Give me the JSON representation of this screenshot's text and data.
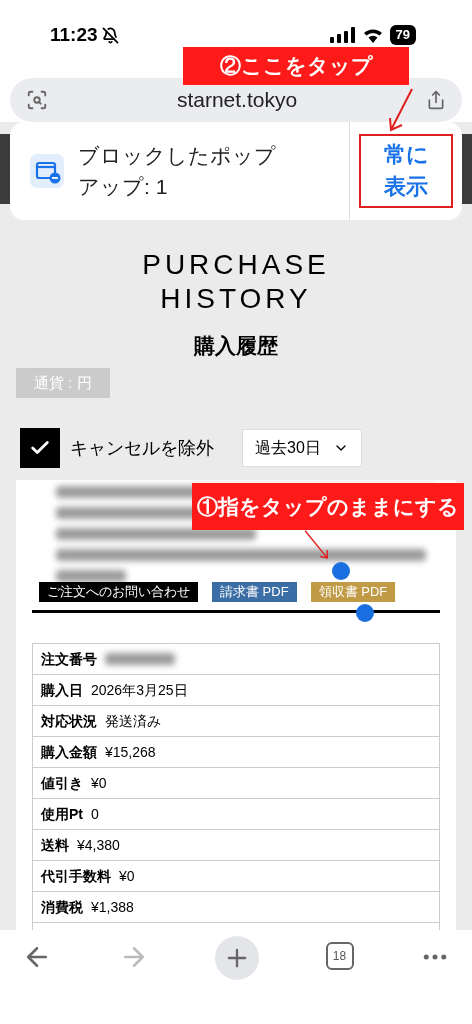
{
  "status_bar": {
    "time": "11:23",
    "battery": "79"
  },
  "address_bar": {
    "url": "starnet.tokyo"
  },
  "popup_notice": {
    "message": "ブロックしたポップアップ: 1",
    "action": "常に表示"
  },
  "annotations": [
    {
      "kind": "top",
      "text": "②ここをタップ"
    },
    {
      "kind": "middle",
      "text": "①指をタップのままにする"
    }
  ],
  "page": {
    "title": "PURCHASE HISTORY",
    "subtitle": "購入履歴",
    "currency": "通貨 : 円",
    "filter": {
      "label": "キャンセルを除外",
      "checked": true
    },
    "period": {
      "value": "過去30日"
    },
    "order_buttons": [
      {
        "label": "ご注文へのお問い合わせ",
        "color": "#000000"
      },
      {
        "label": "請求書 PDF",
        "color": "#3a6ea5"
      },
      {
        "label": "領収書 PDF",
        "color": "#c09a45"
      }
    ],
    "details": [
      {
        "label": "注文番号"
      },
      {
        "label": "購入日",
        "value": "2026年3月25日"
      },
      {
        "label": "対応状況",
        "value": "発送済み"
      },
      {
        "label": "購入金額",
        "value": "¥15,268"
      },
      {
        "label": "値引き",
        "value": "¥0"
      },
      {
        "label": "使用Pt",
        "value": "0"
      },
      {
        "label": "送料",
        "value": "¥4,380"
      },
      {
        "label": "代引手数料",
        "value": "¥0"
      },
      {
        "label": "消費税",
        "value": "¥1,388"
      }
    ]
  },
  "toolbar": {
    "tab_count": "18"
  }
}
